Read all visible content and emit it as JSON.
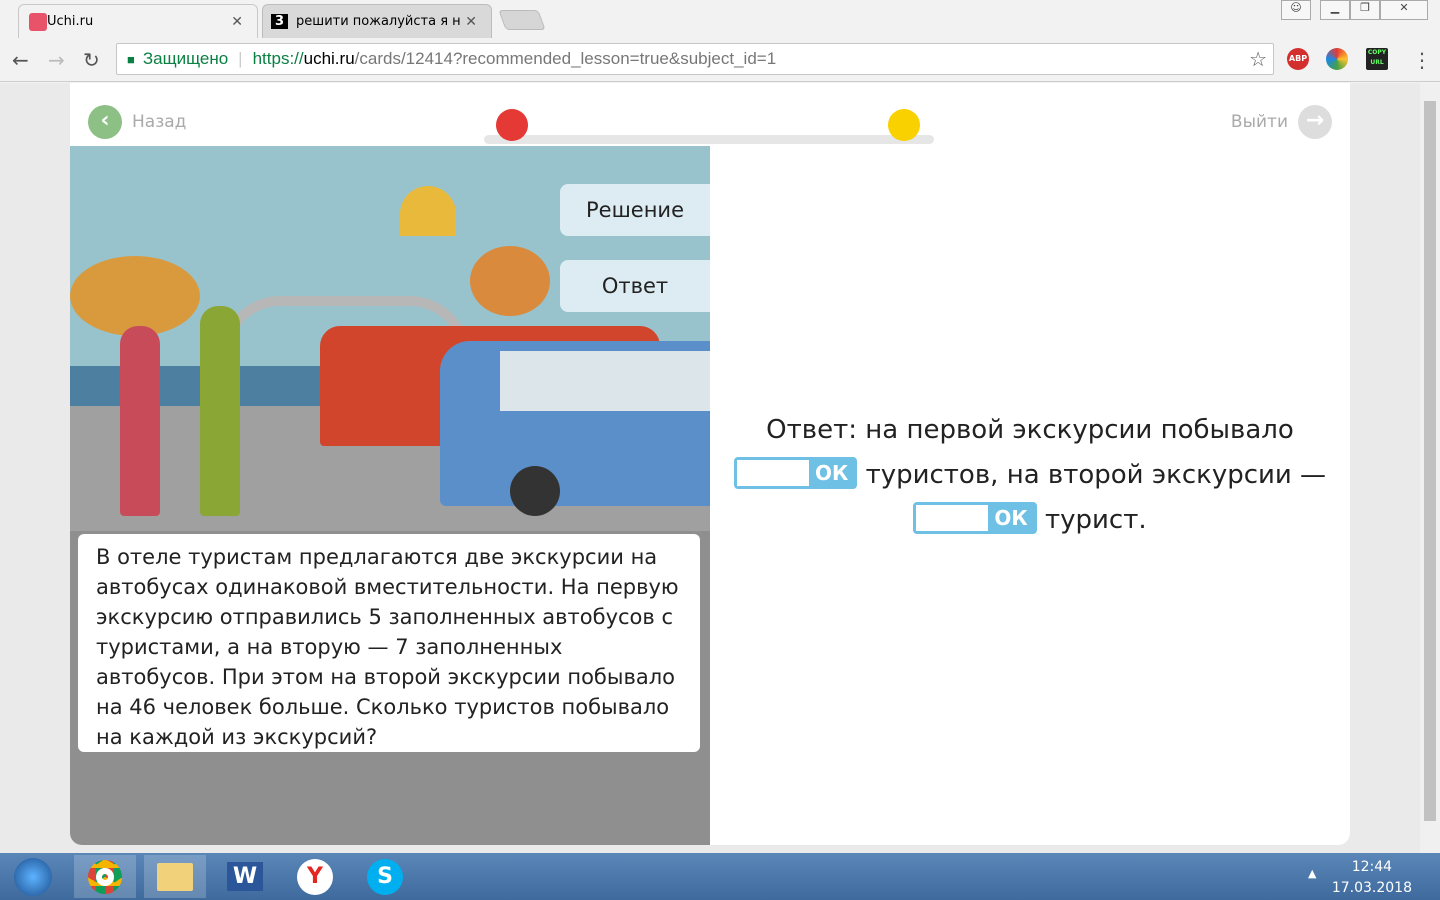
{
  "browser": {
    "tabs": [
      {
        "title": "Uchi.ru",
        "active": true
      },
      {
        "title": "решити пожалуйста я н",
        "active": false,
        "favicon_text": "3"
      }
    ],
    "secure_label": "Защищено",
    "url_prefix": "https://",
    "url_host": "uchi.ru",
    "url_path": "/cards/12414?recommended_lesson=true&subject_id=1",
    "ext_abp": "ABP",
    "ext_copy": "COPY URL"
  },
  "page": {
    "back_label": "Назад",
    "exit_label": "Выйти",
    "progress": 0,
    "buttons": {
      "solution": "Решение",
      "answer": "Ответ"
    },
    "task_text": "В отеле туристам предлагаются две экскурсии на автобусах одинаковой вместительности. На первую экскурсию отправились 5 заполненных автобусов с туристами, а на вторую — 7 заполненных автобусов. При этом на второй экскурсии побывало на 46 человек больше. Сколько туристов побывало на каждой из экскурсий?",
    "answer": {
      "part1": "Ответ: на первой экскурсии побывало",
      "part2": "туристов, на второй экскурсии —",
      "part3": "турист.",
      "ok": "ОК",
      "input1": "",
      "input2": ""
    }
  },
  "colors": {
    "accent": "#6ec1e4",
    "green": "#8cc084"
  },
  "taskbar": {
    "time": "12:44",
    "date": "17.03.2018"
  }
}
